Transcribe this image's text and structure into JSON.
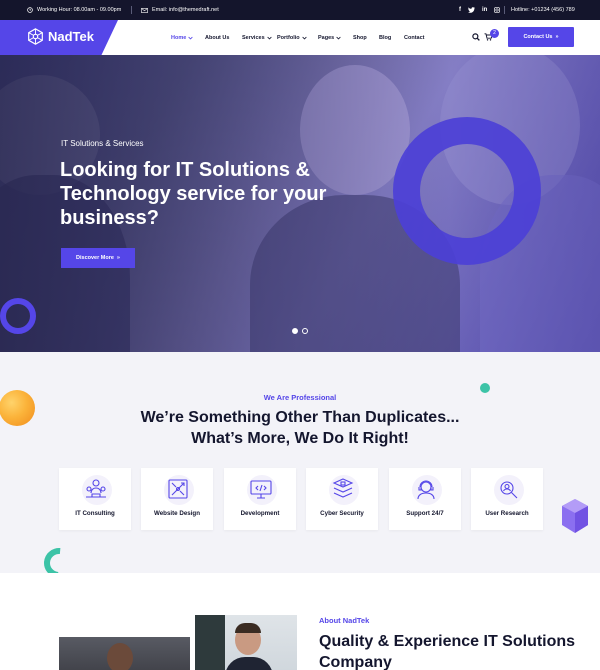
{
  "topbar": {
    "working_hour": "Working Hour: 08.00am - 09.00pm",
    "email": "Email: info@themedraft.net",
    "social": [
      "f",
      "twitter",
      "in",
      "instagram"
    ],
    "hotline": "Hotline: +01234 (456) 789"
  },
  "header": {
    "logo": "NadTek",
    "nav": [
      {
        "label": "Home",
        "dropdown": true,
        "active": true
      },
      {
        "label": "About Us",
        "dropdown": false
      },
      {
        "label": "Services",
        "dropdown": true
      },
      {
        "label": "Portfolio",
        "dropdown": true
      },
      {
        "label": "Pages",
        "dropdown": true
      },
      {
        "label": "Shop",
        "dropdown": false
      },
      {
        "label": "Blog",
        "dropdown": false
      },
      {
        "label": "Contact",
        "dropdown": false
      }
    ],
    "cart_count": "2",
    "contact_button": "Contact Us",
    "accent": "#5546e8"
  },
  "hero": {
    "subtitle": "IT Solutions & Services",
    "title": "Looking for IT Solutions & Technology service for your business?",
    "button": "Discover More",
    "slides": 2,
    "active_slide": 1
  },
  "services": {
    "subtitle": "We Are Professional",
    "title_line1": "We’re Something Other Than Duplicates...",
    "title_line2": "What’s More, We Do It Right!",
    "cards": [
      {
        "label": "IT Consulting",
        "icon": "consulting-icon"
      },
      {
        "label": "Website Design",
        "icon": "design-icon"
      },
      {
        "label": "Development",
        "icon": "development-icon"
      },
      {
        "label": "Cyber Security",
        "icon": "security-icon"
      },
      {
        "label": "Support 24/7",
        "icon": "support-icon"
      },
      {
        "label": "User Research",
        "icon": "research-icon"
      }
    ]
  },
  "about": {
    "subtitle": "About NadTek",
    "title": "Quality & Experience IT Solutions Company"
  }
}
